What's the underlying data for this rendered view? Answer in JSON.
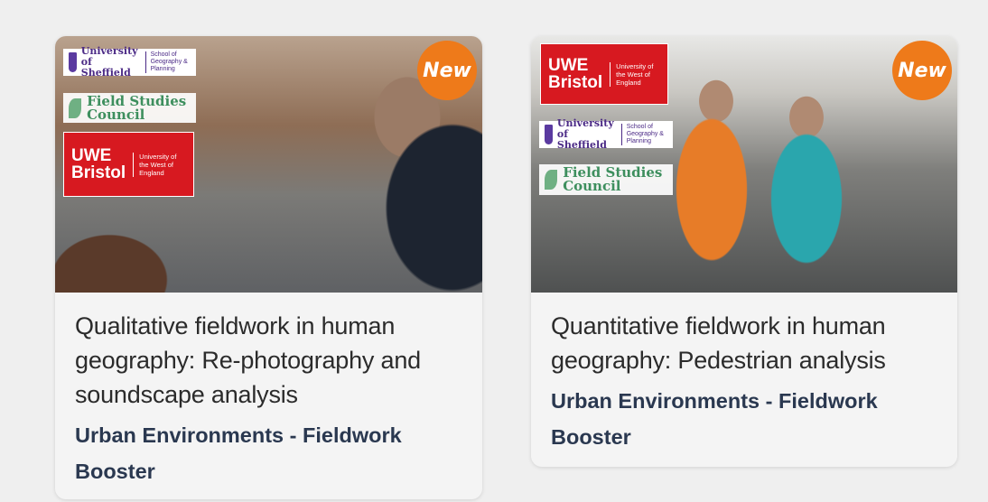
{
  "cards": [
    {
      "title": "Qualitative fieldwork in human geography: Re-photography and soundscape analysis",
      "subtitle": "Urban Environments - Fieldwork Booster",
      "badge": "New",
      "logos": {
        "sheffield": {
          "main": "University of Sheffield",
          "sub": "School of Geography & Planning"
        },
        "fsc": {
          "name": "Field Studies Council"
        },
        "uwe": {
          "big": "UWE Bristol",
          "sub": "University of the West of England"
        }
      }
    },
    {
      "title": "Quantitative fieldwork in human geography: Pedestrian analysis",
      "subtitle": "Urban Environments - Fieldwork Booster",
      "badge": "New",
      "logos": {
        "uwe": {
          "big": "UWE Bristol",
          "sub": "University of the West of England"
        },
        "sheffield": {
          "main": "University of Sheffield",
          "sub": "School of Geography & Planning"
        },
        "fsc": {
          "name": "Field Studies Council"
        }
      }
    }
  ],
  "colors": {
    "badge": "#ee7a1a",
    "subtitle": "#2a3850",
    "title": "#2b2b2b",
    "uwe_red": "#d71920",
    "sheffield_purple": "#4b2a86",
    "fsc_green": "#3e8f5e"
  }
}
